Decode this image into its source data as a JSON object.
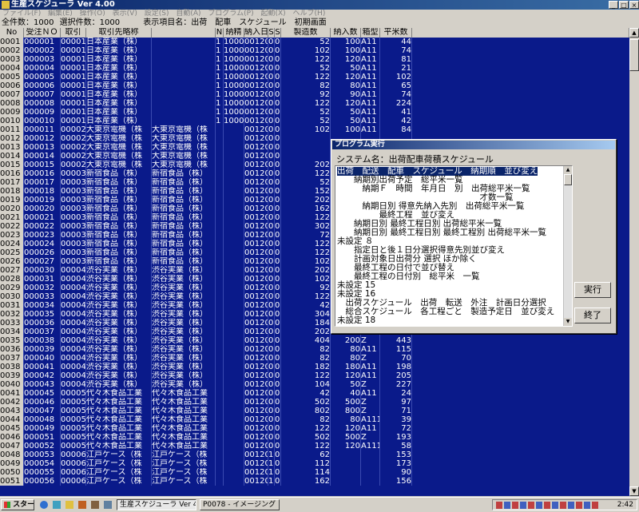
{
  "window": {
    "title": "生産スケジューラ Ver 4.00"
  },
  "menu": [
    "ファイル(F)",
    "編集(E)",
    "操作(O)",
    "表示(V)",
    "設定(S)",
    "自動(A)",
    "プログラム(P)",
    "起動(X)",
    "ヘルプ(H)"
  ],
  "info": {
    "total_label": "全件数",
    "total": "1000",
    "selected_label": "選択件数",
    "selected": "1000",
    "display_label": "表示項目名",
    "display_value": "出荷　配車　スケジュール　初期画面"
  },
  "columns": [
    "No",
    "受注ＮＯ",
    "取引",
    "取引先略称",
    "",
    "N",
    "納精",
    "納入日",
    "S",
    "S",
    "製造数",
    "納入数",
    "箱型",
    "平米数"
  ],
  "rows": [
    [
      "0001",
      "000001",
      "00001",
      "日本産業（株）",
      "",
      "1",
      "1000",
      "001201",
      "0",
      "0",
      "52",
      "100",
      "A11",
      "44"
    ],
    [
      "0002",
      "000002",
      "00001",
      "日本産業（株）",
      "",
      "1",
      "1000",
      "001201",
      "0",
      "0",
      "102",
      "100",
      "A11",
      "74"
    ],
    [
      "0003",
      "000003",
      "00001",
      "日本産業（株）",
      "",
      "1",
      "1000",
      "001201",
      "0",
      "0",
      "122",
      "120",
      "A11",
      "81"
    ],
    [
      "0004",
      "000004",
      "00001",
      "日本産業（株）",
      "",
      "1",
      "1000",
      "001201",
      "0",
      "0",
      "52",
      "50",
      "A11",
      "21"
    ],
    [
      "0005",
      "000005",
      "00001",
      "日本産業（株）",
      "",
      "1",
      "1000",
      "001201",
      "0",
      "0",
      "122",
      "120",
      "A11",
      "102"
    ],
    [
      "0006",
      "000006",
      "00001",
      "日本産業（株）",
      "",
      "1",
      "1000",
      "001201",
      "0",
      "0",
      "82",
      "80",
      "A11",
      "65"
    ],
    [
      "0007",
      "000007",
      "00001",
      "日本産業（株）",
      "",
      "1",
      "1000",
      "001201",
      "0",
      "0",
      "92",
      "90",
      "A11",
      "74"
    ],
    [
      "0008",
      "000008",
      "00001",
      "日本産業（株）",
      "",
      "1",
      "1000",
      "001201",
      "0",
      "0",
      "122",
      "120",
      "A11",
      "224"
    ],
    [
      "0009",
      "000009",
      "00001",
      "日本産業（株）",
      "",
      "1",
      "1000",
      "001201",
      "0",
      "0",
      "52",
      "50",
      "A11",
      "41"
    ],
    [
      "0010",
      "000010",
      "00001",
      "日本産業（株）",
      "",
      "1",
      "1000",
      "001201",
      "0",
      "0",
      "52",
      "50",
      "A11",
      "42"
    ],
    [
      "0011",
      "000011",
      "00002",
      "大東京電機（株",
      "大東京電機（株",
      "",
      "",
      "001201",
      "0",
      "0",
      "102",
      "100",
      "A11",
      "84"
    ],
    [
      "0012",
      "000012",
      "00002",
      "大東京電機（株",
      "大東京電機（株",
      "",
      "",
      "001201",
      "0",
      "0",
      "",
      "",
      "",
      ""
    ],
    [
      "0013",
      "000013",
      "00002",
      "大東京電機（株",
      "大東京電機（株",
      "",
      "",
      "001201",
      "0",
      "0",
      "",
      "",
      "",
      ""
    ],
    [
      "0014",
      "000014",
      "00002",
      "大東京電機（株",
      "大東京電機（株",
      "",
      "",
      "001201",
      "0",
      "0",
      "",
      "",
      "",
      ""
    ],
    [
      "0015",
      "000015",
      "00002",
      "大東京電機（株",
      "大東京電機（株",
      "",
      "",
      "001201",
      "0",
      "0",
      "202",
      "",
      "",
      ""
    ],
    [
      "0016",
      "000016",
      "00003",
      "新宿食品（株）",
      "新宿食品（株）",
      "",
      "",
      "001201",
      "0",
      "0",
      "122",
      "",
      "",
      ""
    ],
    [
      "0017",
      "000017",
      "00003",
      "新宿食品（株）",
      "新宿食品（株）",
      "",
      "",
      "001201",
      "0",
      "0",
      "52",
      "",
      "",
      ""
    ],
    [
      "0018",
      "000018",
      "00003",
      "新宿食品（株）",
      "新宿食品（株）",
      "",
      "",
      "001201",
      "0",
      "0",
      "152",
      "",
      "",
      ""
    ],
    [
      "0019",
      "000019",
      "00003",
      "新宿食品（株）",
      "新宿食品（株）",
      "",
      "",
      "001201",
      "0",
      "0",
      "202",
      "",
      "",
      ""
    ],
    [
      "0020",
      "000020",
      "00003",
      "新宿食品（株）",
      "新宿食品（株）",
      "",
      "",
      "001201",
      "0",
      "0",
      "162",
      "",
      "",
      ""
    ],
    [
      "0021",
      "000021",
      "00003",
      "新宿食品（株）",
      "新宿食品（株）",
      "",
      "",
      "001201",
      "0",
      "0",
      "122",
      "",
      "",
      ""
    ],
    [
      "0022",
      "000022",
      "00003",
      "新宿食品（株）",
      "新宿食品（株）",
      "",
      "",
      "001201",
      "0",
      "0",
      "302",
      "",
      "",
      ""
    ],
    [
      "0023",
      "000023",
      "00003",
      "新宿食品（株）",
      "新宿食品（株）",
      "",
      "",
      "001201",
      "0",
      "0",
      "72",
      "",
      "",
      ""
    ],
    [
      "0024",
      "000024",
      "00003",
      "新宿食品（株）",
      "新宿食品（株）",
      "",
      "",
      "001201",
      "0",
      "0",
      "122",
      "",
      "",
      ""
    ],
    [
      "0025",
      "000026",
      "00003",
      "新宿食品（株）",
      "新宿食品（株）",
      "",
      "",
      "001201",
      "0",
      "0",
      "122",
      "",
      "",
      ""
    ],
    [
      "0026",
      "000027",
      "00003",
      "新宿食品（株）",
      "新宿食品（株）",
      "",
      "",
      "001201",
      "0",
      "0",
      "102",
      "",
      "",
      ""
    ],
    [
      "0027",
      "000030",
      "00004",
      "渋谷実業（株）",
      "渋谷実業（株）",
      "",
      "",
      "001201",
      "0",
      "0",
      "202",
      "",
      "",
      ""
    ],
    [
      "0028",
      "000031",
      "00004",
      "渋谷実業（株）",
      "渋谷実業（株）",
      "",
      "",
      "001201",
      "0",
      "0",
      "102",
      "",
      "",
      ""
    ],
    [
      "0029",
      "000032",
      "00004",
      "渋谷実業（株）",
      "渋谷実業（株）",
      "",
      "",
      "001201",
      "0",
      "0",
      "92",
      "",
      "",
      ""
    ],
    [
      "0030",
      "000033",
      "00004",
      "渋谷実業（株）",
      "渋谷実業（株）",
      "",
      "",
      "001201",
      "0",
      "0",
      "122",
      "",
      "",
      ""
    ],
    [
      "0031",
      "000034",
      "00004",
      "渋谷実業（株）",
      "渋谷実業（株）",
      "",
      "",
      "001201",
      "0",
      "0",
      "42",
      "",
      "",
      ""
    ],
    [
      "0032",
      "000035",
      "00004",
      "渋谷実業（株）",
      "渋谷実業（株）",
      "",
      "",
      "001201",
      "0",
      "0",
      "304",
      "",
      "",
      ""
    ],
    [
      "0033",
      "000036",
      "00004",
      "渋谷実業（株）",
      "渋谷実業（株）",
      "",
      "",
      "001201",
      "0",
      "0",
      "184",
      "",
      "",
      ""
    ],
    [
      "0034",
      "000037",
      "00004",
      "渋谷実業（株）",
      "渋谷実業（株）",
      "",
      "",
      "001201",
      "0",
      "0",
      "202",
      "200",
      "A11",
      "295"
    ],
    [
      "0035",
      "000038",
      "00004",
      "渋谷実業（株）",
      "渋谷実業（株）",
      "",
      "",
      "001201",
      "0",
      "0",
      "404",
      "200",
      "Z",
      "443"
    ],
    [
      "0036",
      "000039",
      "00004",
      "渋谷実業（株）",
      "渋谷実業（株）",
      "",
      "",
      "001201",
      "0",
      "0",
      "82",
      "80",
      "A11",
      "115"
    ],
    [
      "0037",
      "000040",
      "00004",
      "渋谷実業（株）",
      "渋谷実業（株）",
      "",
      "",
      "001201",
      "0",
      "0",
      "82",
      "80",
      "Z",
      "70"
    ],
    [
      "0038",
      "000041",
      "00004",
      "渋谷実業（株）",
      "渋谷実業（株）",
      "",
      "",
      "001201",
      "0",
      "0",
      "182",
      "180",
      "A11",
      "198"
    ],
    [
      "0039",
      "000042",
      "00004",
      "渋谷実業（株）",
      "渋谷実業（株）",
      "",
      "",
      "001201",
      "0",
      "0",
      "122",
      "120",
      "A11",
      "205"
    ],
    [
      "0040",
      "000043",
      "00004",
      "渋谷実業（株）",
      "渋谷実業（株）",
      "",
      "",
      "001201",
      "0",
      "0",
      "104",
      "50",
      "Z",
      "227"
    ],
    [
      "0041",
      "000045",
      "00005",
      "代々木食品工業",
      "代々木食品工業",
      "",
      "",
      "001201",
      "0",
      "0",
      "42",
      "40",
      "A11",
      "24"
    ],
    [
      "0042",
      "000046",
      "00005",
      "代々木食品工業",
      "代々木食品工業",
      "",
      "",
      "001201",
      "0",
      "0",
      "502",
      "500",
      "Z",
      "97"
    ],
    [
      "0043",
      "000047",
      "00005",
      "代々木食品工業",
      "代々木食品工業",
      "",
      "",
      "001201",
      "0",
      "0",
      "802",
      "800",
      "Z",
      "71"
    ],
    [
      "0044",
      "000048",
      "00005",
      "代々木食品工業",
      "代々木食品工業",
      "",
      "",
      "001201",
      "0",
      "0",
      "82",
      "80",
      "A111",
      "39"
    ],
    [
      "0045",
      "000049",
      "00005",
      "代々木食品工業",
      "代々木食品工業",
      "",
      "",
      "001201",
      "0",
      "0",
      "122",
      "120",
      "A11",
      "72"
    ],
    [
      "0046",
      "000051",
      "00005",
      "代々木食品工業",
      "代々木食品工業",
      "",
      "",
      "001201",
      "0",
      "0",
      "502",
      "500",
      "Z",
      "193"
    ],
    [
      "0047",
      "000052",
      "00005",
      "代々木食品工業",
      "代々木食品工業",
      "",
      "",
      "001201",
      "0",
      "0",
      "122",
      "120",
      "A111",
      "58"
    ],
    [
      "0048",
      "000053",
      "00006",
      "江戸ケース（株",
      "江戸ケース（株",
      "",
      "",
      "001201",
      "1",
      "0",
      "62",
      "",
      "",
      "153"
    ],
    [
      "0049",
      "000054",
      "00006",
      "江戸ケース（株",
      "江戸ケース（株",
      "",
      "",
      "001201",
      "1",
      "0",
      "112",
      "",
      "",
      "173"
    ],
    [
      "0050",
      "000055",
      "00006",
      "江戸ケース（株",
      "江戸ケース（株",
      "",
      "",
      "001201",
      "1",
      "0",
      "114",
      "",
      "",
      "90"
    ],
    [
      "0051",
      "000056",
      "00006",
      "江戸ケース（株",
      "江戸ケース（株",
      "",
      "",
      "001201",
      "1",
      "0",
      "162",
      "",
      "",
      "156"
    ]
  ],
  "dialog": {
    "title": "プログラム実行",
    "system_name": "システム名：出荷配車荷積スケジュール",
    "items": [
      "出荷　配送　配車　スケジュール　納期順　並び変え",
      "　　納期別出荷予定　総平米一覧",
      "　　　納期Ｆ　時間　年月日　別　出荷総平米一覧",
      "　　　　　　　　　　　　　　　　　才数一覧",
      "　　　納期日別 得意先納入先別　出荷総平米一覧",
      "　　　　　最終工程　並び変え",
      "　　納期日別 最終工程日別 出荷総平米一覧",
      "　　納期日別 最終工程日別 最終工程別 出荷総平米一覧",
      "未設定 ８",
      "　　指定日と後１日分選択得意先別並び変え",
      "　　計画対象日出荷分 選択 ほか除く",
      "　　最終工程の日付で並び替え",
      "　　最終工程の日付別　総平米　一覧",
      "未設定 15",
      "未設定 16",
      "　出荷スケジュール　出荷　転送　外注　計画日分選択",
      "　総合スケジュール　各工程ごと　製造予定日　並び変え",
      "未設定 18"
    ],
    "run_button": "実行",
    "close_button": "終了"
  },
  "taskbar": {
    "start": "スタート",
    "tasks": [
      "生産スケジューラ Ver 4...",
      "P0078 - イメージング"
    ],
    "clock": "2:42"
  }
}
